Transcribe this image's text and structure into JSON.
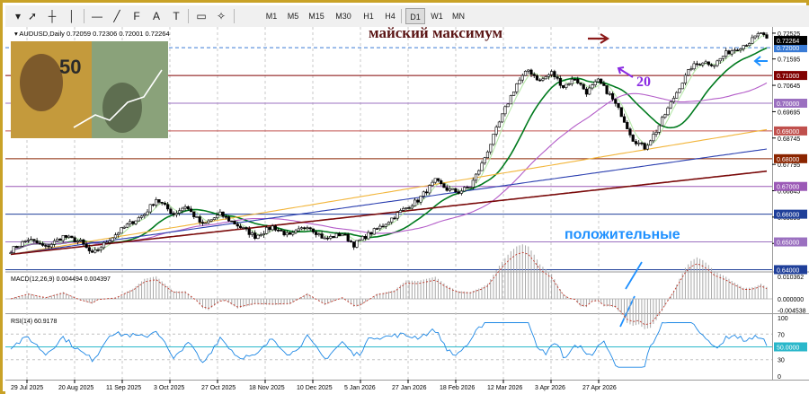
{
  "toolbar": {
    "tools": [
      {
        "name": "dropdown-arrow-icon",
        "glyph": "▾"
      },
      {
        "name": "cursor-icon",
        "glyph": "➚"
      },
      {
        "name": "crosshair-icon",
        "glyph": "┼"
      },
      {
        "name": "vertical-line-icon",
        "glyph": "│"
      },
      {
        "name": "horizontal-line-icon",
        "glyph": "—"
      },
      {
        "name": "trendline-icon",
        "glyph": "╱"
      },
      {
        "name": "fibonacci-icon",
        "glyph": "F"
      },
      {
        "name": "text-icon",
        "glyph": "A"
      },
      {
        "name": "text-label-icon",
        "glyph": "T"
      },
      {
        "name": "rectangle-icon",
        "glyph": "▭"
      },
      {
        "name": "shapes-icon",
        "glyph": "✧"
      }
    ],
    "timeframes": [
      "M1",
      "M5",
      "M15",
      "M30",
      "H1",
      "H4",
      "D1",
      "W1",
      "MN"
    ],
    "active_timeframe": "D1"
  },
  "chart_data": {
    "type": "candlestick",
    "symbol_header": "AUDUSD,Daily 0.72059 0.72306 0.72001 0.72264",
    "price_ylim": [
      0.6395,
      0.7275
    ],
    "price_ticks": [
      "0.72525",
      "0.71595",
      "0.70645",
      "0.69695",
      "0.68745",
      "0.67795",
      "0.66845",
      "0.65895",
      "0.64945"
    ],
    "level_labels": [
      {
        "price": 0.72,
        "label": "0.72000",
        "color": "#3a7bd5"
      },
      {
        "price": 0.71,
        "label": "0.71000",
        "color": "#800000"
      },
      {
        "price": 0.7,
        "label": "0.70000",
        "color": "#9b70c0"
      },
      {
        "price": 0.69,
        "label": "0.69000",
        "color": "#c0504d"
      },
      {
        "price": 0.68,
        "label": "0.68000",
        "color": "#8b2500"
      },
      {
        "price": 0.67,
        "label": "0.67000",
        "color": "#9b59b6"
      },
      {
        "price": 0.66,
        "label": "0.66000",
        "color": "#1f3f99"
      },
      {
        "price": 0.65,
        "label": "0.65000",
        "color": "#9b70c0"
      },
      {
        "price": 0.64,
        "label": "0.64000",
        "color": "#1f3f99"
      }
    ],
    "current_price_label": "0.72264",
    "dates": [
      "29 Jul 2025",
      "20 Aug 2025",
      "11 Sep 2025",
      "3 Oct 2025",
      "27 Oct 2025",
      "18 Nov 2025",
      "10 Dec 2025",
      "5 Jan 2026",
      "27 Jan 2026",
      "18 Feb 2026",
      "12 Mar 2026",
      "3 Apr 2026",
      "27 Apr 2026"
    ],
    "close_path": [
      [
        0,
        0.647
      ],
      [
        6,
        0.651
      ],
      [
        12,
        0.648
      ],
      [
        18,
        0.652
      ],
      [
        24,
        0.65
      ],
      [
        28,
        0.6455
      ],
      [
        34,
        0.651
      ],
      [
        40,
        0.656
      ],
      [
        46,
        0.66
      ],
      [
        50,
        0.6655
      ],
      [
        56,
        0.66
      ],
      [
        60,
        0.663
      ],
      [
        66,
        0.656
      ],
      [
        72,
        0.66
      ],
      [
        78,
        0.656
      ],
      [
        84,
        0.652
      ],
      [
        90,
        0.6555
      ],
      [
        96,
        0.652
      ],
      [
        102,
        0.656
      ],
      [
        108,
        0.651
      ],
      [
        114,
        0.653
      ],
      [
        118,
        0.649
      ],
      [
        122,
        0.652
      ],
      [
        128,
        0.656
      ],
      [
        134,
        0.661
      ],
      [
        140,
        0.665
      ],
      [
        146,
        0.672
      ],
      [
        150,
        0.669
      ],
      [
        154,
        0.668
      ],
      [
        158,
        0.67
      ],
      [
        162,
        0.678
      ],
      [
        166,
        0.688
      ],
      [
        170,
        0.698
      ],
      [
        174,
        0.707
      ],
      [
        178,
        0.712
      ],
      [
        182,
        0.708
      ],
      [
        186,
        0.711
      ],
      [
        190,
        0.706
      ],
      [
        194,
        0.709
      ],
      [
        198,
        0.704
      ],
      [
        202,
        0.708
      ],
      [
        206,
        0.703
      ],
      [
        210,
        0.696
      ],
      [
        214,
        0.687
      ],
      [
        218,
        0.684
      ],
      [
        222,
        0.69
      ],
      [
        226,
        0.698
      ],
      [
        230,
        0.706
      ],
      [
        234,
        0.713
      ],
      [
        238,
        0.715
      ],
      [
        242,
        0.714
      ],
      [
        246,
        0.718
      ],
      [
        250,
        0.72
      ],
      [
        254,
        0.722
      ],
      [
        258,
        0.7255
      ],
      [
        260,
        0.7226
      ]
    ],
    "ma_periods": [
      5,
      20,
      50,
      100,
      200,
      300
    ],
    "ma_colors": [
      "#b5e8a8",
      "#007a1e",
      "#b45ec9",
      "#f2b53a",
      "#2b3fb0",
      "#7a0a0a"
    ],
    "macd_header": "MACD(12,26,9) 0.004494 0.004397",
    "macd_ylim": [
      -0.00538,
      0.010362
    ],
    "macd_ticks": [
      "0.010362",
      "0.000000",
      "-0.004538"
    ],
    "rsi_header": "RSI(14) 60.9178",
    "rsi_ylim": [
      0,
      100
    ],
    "rsi_ticks": [
      "100",
      "70",
      "50.0000",
      "30",
      "0"
    ]
  },
  "annotations": {
    "may_high": "майский максимум",
    "ma_period": "20",
    "positive": "положительные"
  },
  "colors": {
    "bull_body": "#ffffff",
    "bear_body": "#000000",
    "annotation_text": "#5a1414",
    "annotation_blue": "#1e90ff",
    "annotation_purple": "#8a2be2",
    "frame": "#c9a227"
  }
}
